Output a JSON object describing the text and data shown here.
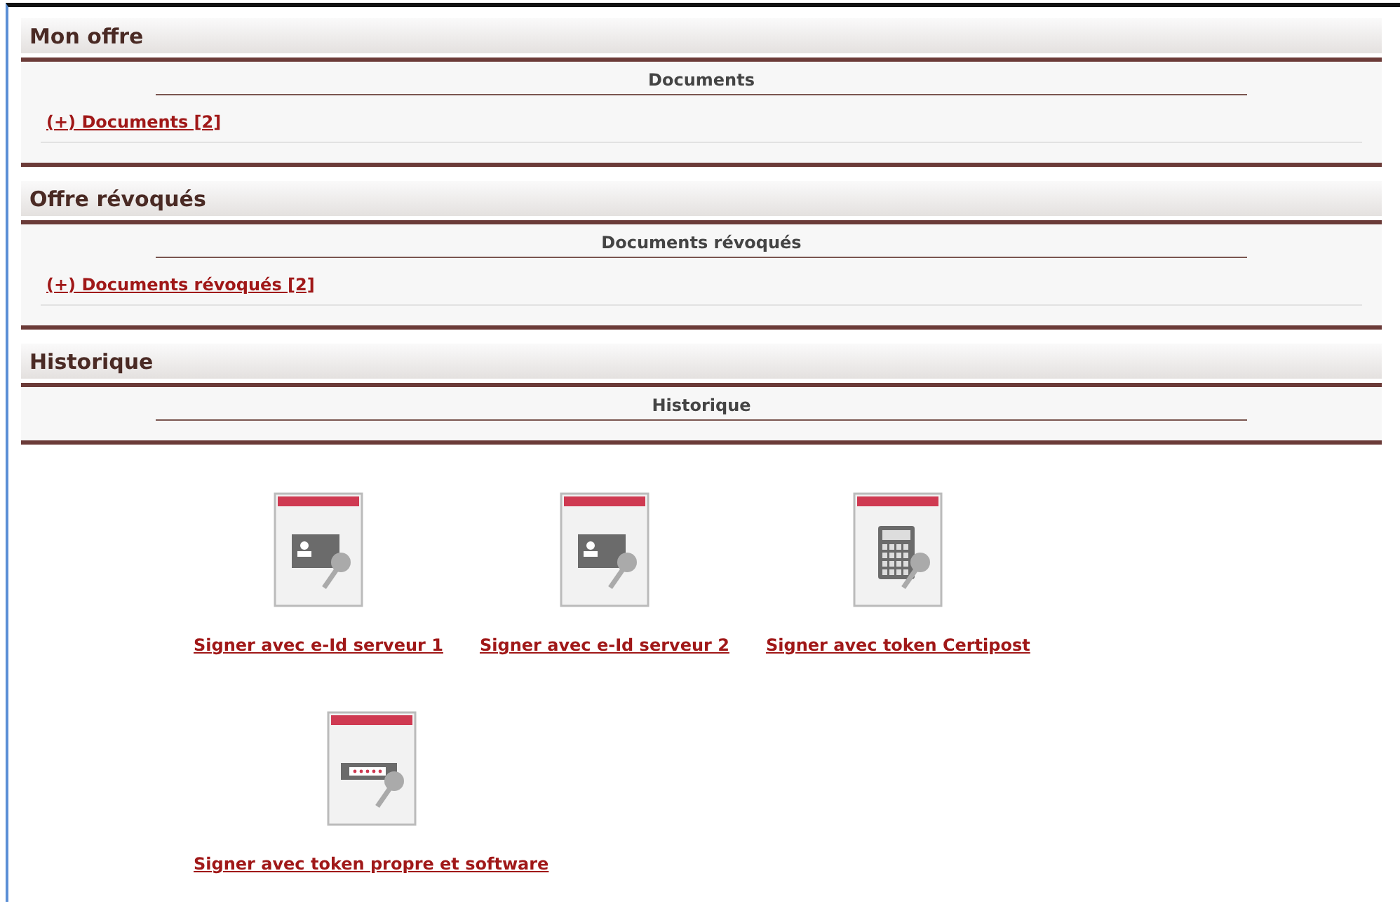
{
  "sections": [
    {
      "title": "Mon offre",
      "header": "Documents",
      "link": "(+) Documents [2]"
    },
    {
      "title": "Offre révoqués",
      "header": "Documents révoqués",
      "link": "(+) Documents révoqués [2]"
    },
    {
      "title": "Historique",
      "header": "Historique"
    }
  ],
  "sign_options": [
    {
      "kind": "id-card",
      "label": "Signer avec e-Id serveur 1"
    },
    {
      "kind": "id-card",
      "label": "Signer avec e-Id serveur 2"
    },
    {
      "kind": "calculator",
      "label": "Signer avec token Certipost"
    },
    {
      "kind": "password",
      "label": "Signer avec token propre et software"
    }
  ]
}
